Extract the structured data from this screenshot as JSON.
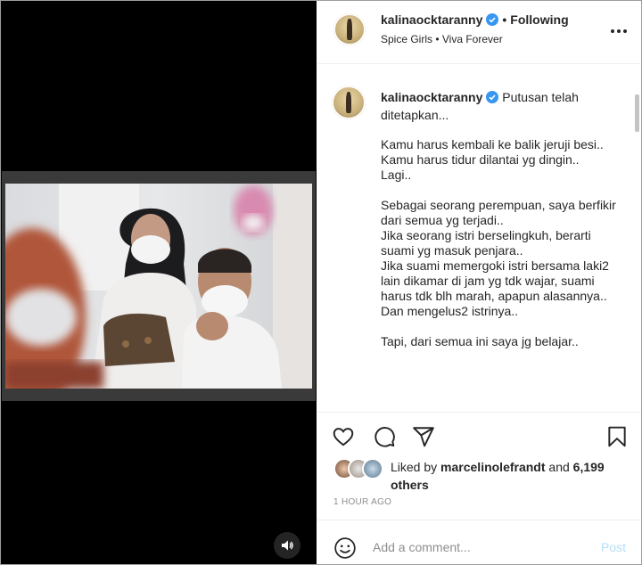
{
  "header": {
    "username": "kalinaocktaranny",
    "separator": "•",
    "follow_status": "Following",
    "audio": "Spice Girls • Viva Forever"
  },
  "caption": {
    "username": "kalinaocktaranny",
    "headline": "Putusan telah ditetapkan...",
    "body": "Kamu harus kembali ke balik jeruji besi..\nKamu harus tidur dilantai yg dingin..\nLagi..\n\nSebagai seorang perempuan, saya berfikir dari semua yg terjadi..\nJika seorang istri berselingkuh, berarti suami yg masuk penjara..\nJika suami memergoki istri bersama laki2 lain dikamar di jam yg tdk wajar, suami harus tdk blh marah, apapun alasannya..\nDan mengelus2 istrinya..\n\nTapi, dari semua ini saya jg belajar.."
  },
  "likes": {
    "prefix": "Liked by",
    "user": "marcelinolefrandt",
    "and": "and",
    "others": "6,199 others"
  },
  "timestamp": "1 HOUR AGO",
  "comment": {
    "placeholder": "Add a comment...",
    "post_label": "Post"
  },
  "icons": {
    "verified": "verified-badge-icon",
    "more": "more-options-icon",
    "like": "heart-icon",
    "comment": "comment-icon",
    "share": "share-icon",
    "save": "bookmark-icon",
    "emoji": "emoji-icon",
    "sound": "speaker-icon"
  },
  "colors": {
    "verified": "#3897f0",
    "post_disabled": "#b2dffc",
    "muted_text": "#8e8e8e"
  }
}
